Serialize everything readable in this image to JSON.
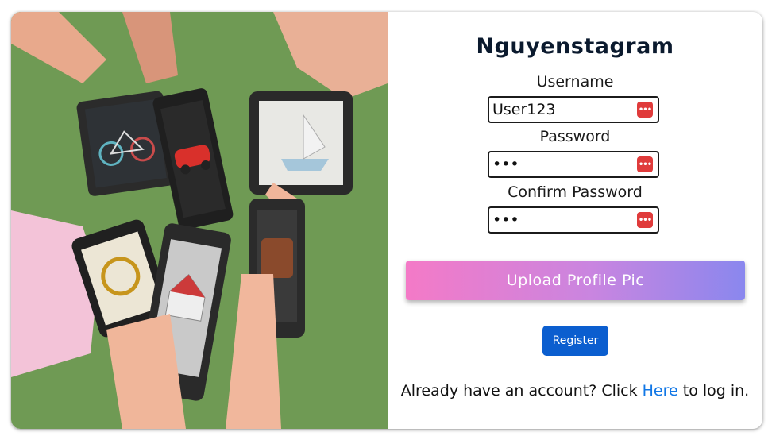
{
  "app": {
    "title": "Nguyenstagram"
  },
  "form": {
    "username_label": "Username",
    "username_value": "User123",
    "password_label": "Password",
    "password_value": "•••",
    "confirm_label": "Confirm Password",
    "confirm_value": "•••",
    "upload_label": "Upload Profile Pic",
    "register_label": "Register"
  },
  "login": {
    "prefix": "Already have an account? Click ",
    "link_text": "Here",
    "suffix": " to log in."
  },
  "colors": {
    "upload_gradient": [
      "#f47ac7",
      "#8a87ee"
    ],
    "register_bg": "#0b5ecf",
    "link": "#1177e6",
    "password_icon": "#e03b3b"
  },
  "icons": {
    "password_manager": "password-manager-icon"
  }
}
